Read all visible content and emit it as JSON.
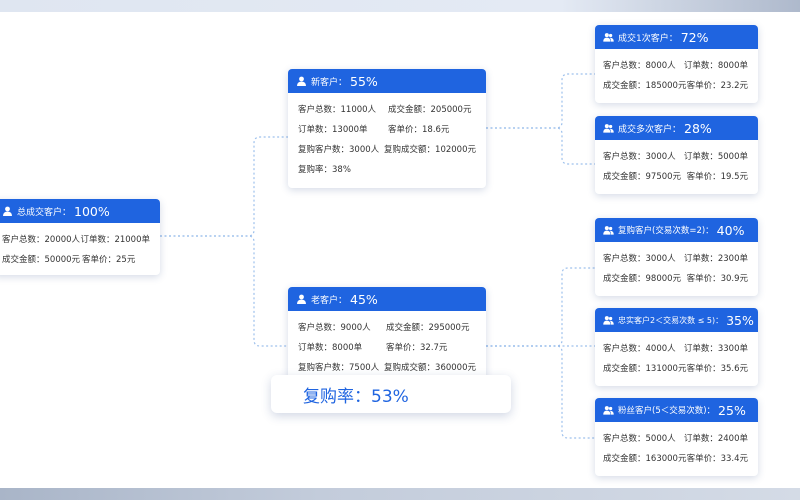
{
  "root": {
    "label": "总成交客户：",
    "pct": "100%",
    "rows": [
      [
        "客户总数：20000人",
        "订单数：21000单"
      ],
      [
        "成交金额：50000元",
        "客单价：25元"
      ]
    ]
  },
  "new": {
    "label": "新客户：",
    "pct": "55%",
    "rows": [
      [
        "客户总数：11000人",
        "成交金额：205000元"
      ],
      [
        "订单数：13000单",
        "客单价：18.6元"
      ],
      [
        "复购客户数：3000人",
        "复购成交额：102000元"
      ],
      [
        "复购率：38%"
      ]
    ]
  },
  "old": {
    "label": "老客户：",
    "pct": "45%",
    "rows": [
      [
        "客户总数：9000人",
        "成交金额：295000元"
      ],
      [
        "订单数：8000单",
        "客单价：32.7元"
      ],
      [
        "复购客户数：7500人",
        "复购成交额：360000元"
      ]
    ]
  },
  "once": {
    "label": "成交1次客户：",
    "pct": "72%",
    "rows": [
      [
        "客户总数：8000人",
        "订单数：8000单"
      ],
      [
        "成交金额：185000元",
        "客单价：23.2元"
      ]
    ]
  },
  "multi": {
    "label": "成交多次客户：",
    "pct": "28%",
    "rows": [
      [
        "客户总数：3000人",
        "订单数：5000单"
      ],
      [
        "成交金额：97500元",
        "客单价：19.5元"
      ]
    ]
  },
  "repeat": {
    "label": "复购客户(交易次数=2)：",
    "pct": "40%",
    "rows": [
      [
        "客户总数：3000人",
        "订单数：2300单"
      ],
      [
        "成交金额：98000元",
        "客单价：30.9元"
      ]
    ]
  },
  "loyal": {
    "label": "忠实客户2＜交易次数 ≤ 5)：",
    "pct": "35%",
    "rows": [
      [
        "客户总数：4000人",
        "订单数：3300单"
      ],
      [
        "成交金额：131000元",
        "客单价：35.6元"
      ]
    ]
  },
  "fans": {
    "label": "粉丝客户(5＜交易次数)：",
    "pct": "25%",
    "rows": [
      [
        "客户总数：5000人",
        "订单数：2400单"
      ],
      [
        "成交金额：163000元",
        "客单价：33.4元"
      ]
    ]
  },
  "overlay": {
    "text": "复购率：53%"
  },
  "colors": {
    "header_blue": "#1f64e0",
    "connector": "#9dc0ec",
    "overlay_text": "#1f64e0"
  },
  "icon": "user-icon"
}
